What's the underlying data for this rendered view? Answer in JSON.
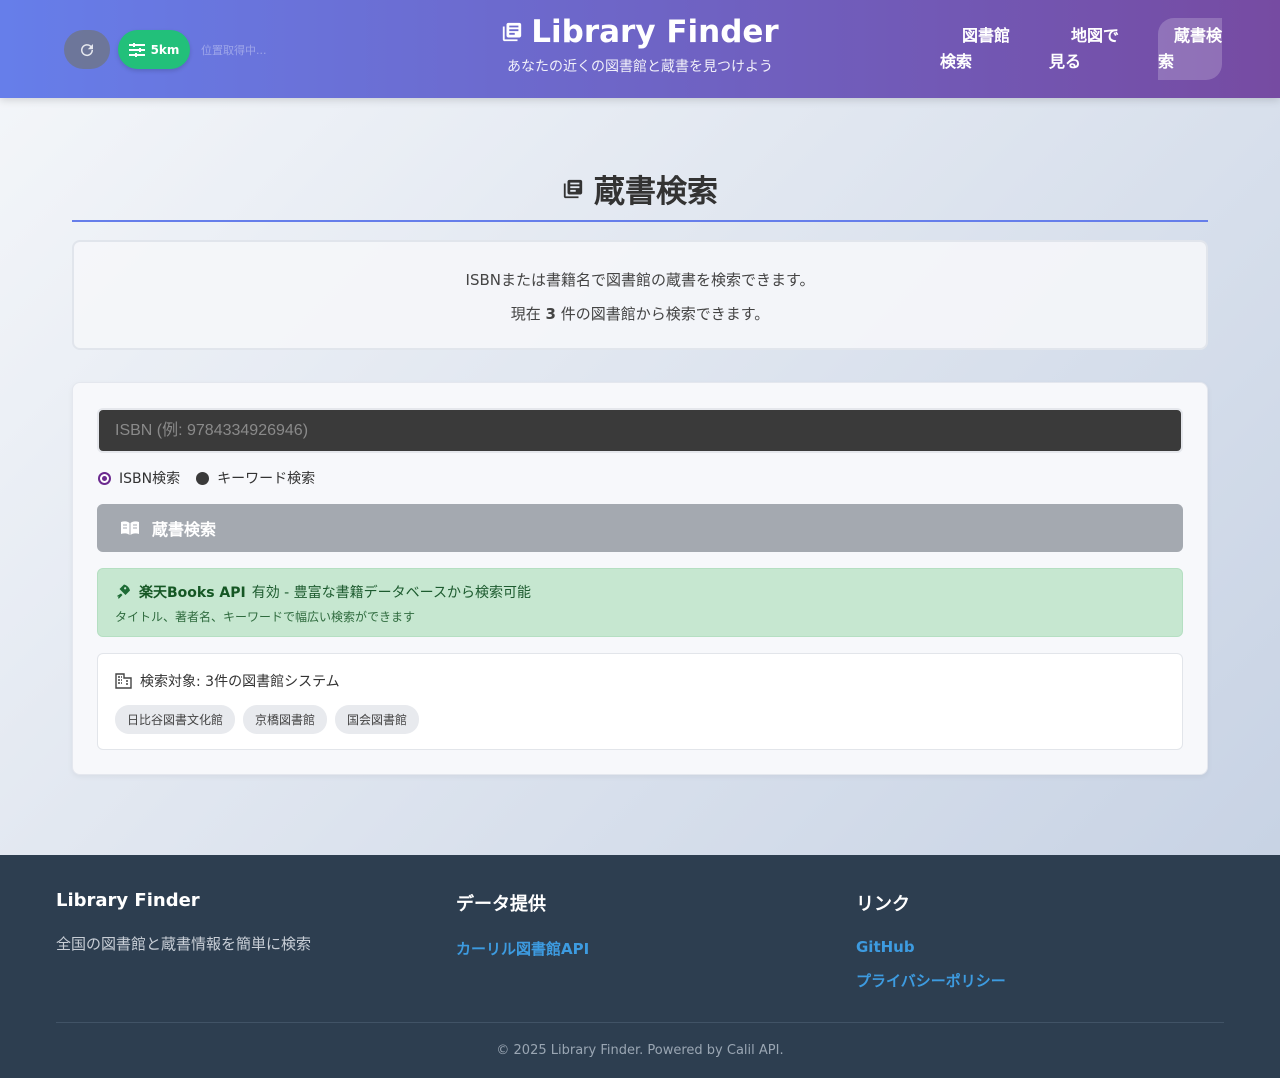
{
  "header": {
    "refresh_icon": "refresh-icon",
    "radius_label": "5km",
    "location_status": "位置取得中...",
    "title": "Library Finder",
    "subtitle": "あなたの近くの図書館と蔵書を見つけよう",
    "nav": [
      {
        "line1": "図書館",
        "line2": "検索"
      },
      {
        "line1": "地図で",
        "line2": "見る"
      },
      {
        "line1": "蔵書検",
        "line2": "索"
      }
    ]
  },
  "main": {
    "title": "蔵書検索",
    "info_line1": "ISBNまたは書籍名で図書館の蔵書を検索できます。",
    "info_line2_prefix": "現在",
    "info_count": "3",
    "info_line2_suffix": "件の図書館から検索できます。",
    "search": {
      "placeholder": "ISBN (例: 9784334926946)",
      "value": "",
      "radio_isbn": "ISBN検索",
      "radio_keyword": "キーワード検索",
      "selected": "isbn",
      "button_label": "蔵書検索"
    },
    "api_notice": {
      "strong": "楽天Books API",
      "rest": "有効 - 豊富な書籍データベースから検索可能",
      "sub": "タイトル、著者名、キーワードで幅広い検索ができます"
    },
    "targets": {
      "heading": "検索対象: 3件の図書館システム",
      "libraries": [
        "日比谷図書文化館",
        "京橋図書館",
        "国会図書館"
      ]
    }
  },
  "footer": {
    "col1_title": "Library Finder",
    "col1_text": "全国の図書館と蔵書情報を簡単に検索",
    "col2_title": "データ提供",
    "col2_link": "カーリル図書館API",
    "col3_title": "リンク",
    "col3_links": [
      "GitHub",
      "プライバシーポリシー"
    ],
    "copyright": "© 2025 Library Finder. Powered by Calil API."
  },
  "colors": {
    "header_start": "#667eea",
    "header_end": "#764ba2",
    "radius_button": "#22c07a",
    "footer_bg": "#2d3e50",
    "link": "#3d9be0"
  }
}
